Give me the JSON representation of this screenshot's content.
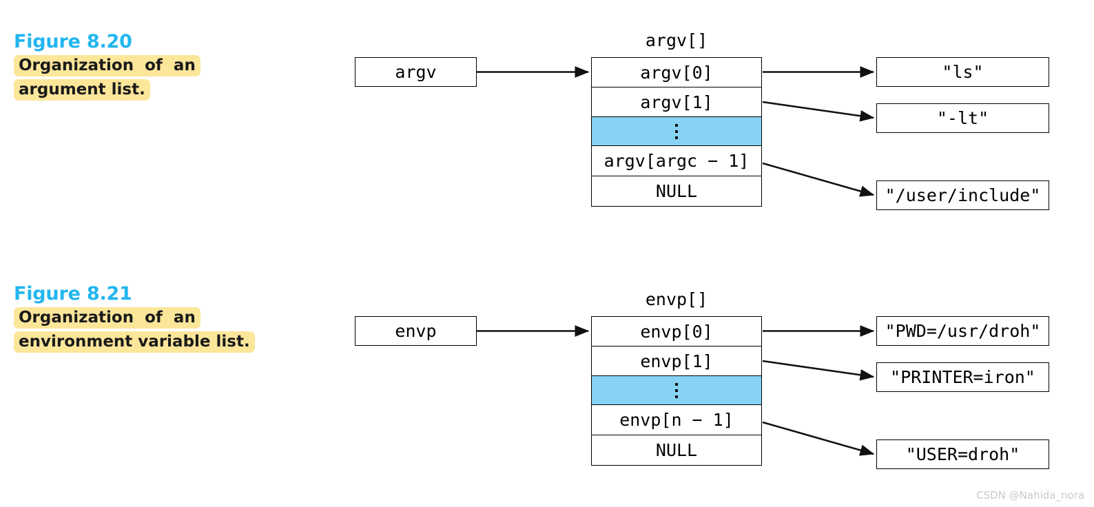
{
  "figures": [
    {
      "id": "8.20",
      "title": "Figure 8.20",
      "caption_lines": [
        "Organization  of  an",
        "argument list."
      ],
      "pointer_label": "argv",
      "array_title": "argv[]",
      "array_cells": [
        {
          "label": "argv[0]",
          "filled": false
        },
        {
          "label": "argv[1]",
          "filled": false
        },
        {
          "label": "",
          "filled": true
        },
        {
          "label": "argv[argc − 1]",
          "filled": false
        },
        {
          "label": "NULL",
          "filled": false
        }
      ],
      "strings": [
        "\"ls\"",
        "\"-lt\"",
        "\"/user/include\""
      ]
    },
    {
      "id": "8.21",
      "title": "Figure 8.21",
      "caption_lines": [
        "Organization  of  an",
        "environment variable list."
      ],
      "pointer_label": "envp",
      "array_title": "envp[]",
      "array_cells": [
        {
          "label": "envp[0]",
          "filled": false
        },
        {
          "label": "envp[1]",
          "filled": false
        },
        {
          "label": "",
          "filled": true
        },
        {
          "label": "envp[n − 1]",
          "filled": false
        },
        {
          "label": "NULL",
          "filled": false
        }
      ],
      "strings": [
        "\"PWD=/usr/droh\"",
        "\"PRINTER=iron\"",
        "\"USER=droh\""
      ]
    }
  ],
  "watermark": "CSDN @Nahida_nora",
  "colors": {
    "heading": "#21b6ef",
    "highlight": "#fce69a",
    "cell_fill": "#86d3f5",
    "stroke": "#000000"
  }
}
